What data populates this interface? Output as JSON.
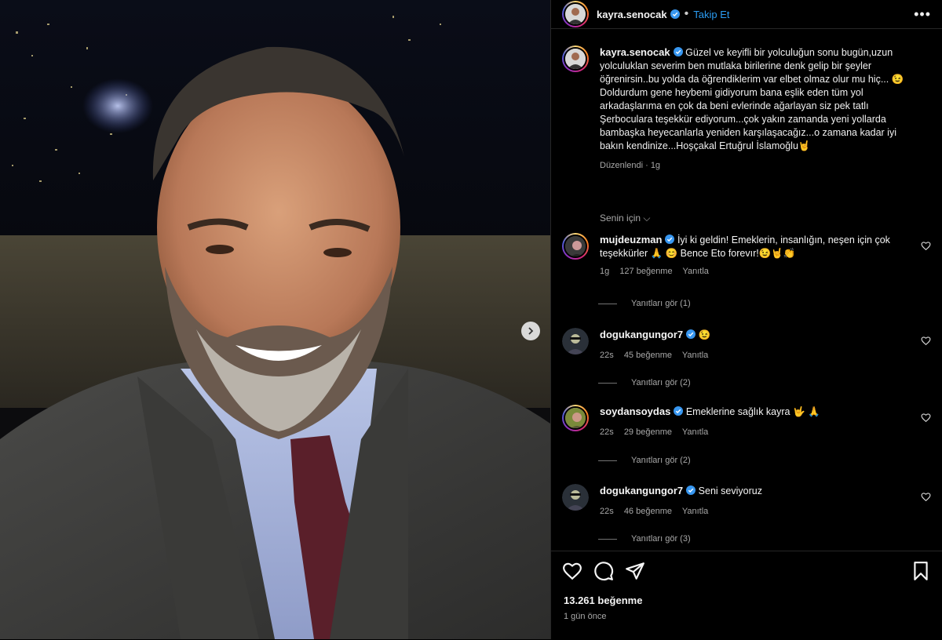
{
  "header": {
    "username": "kayra.senocak",
    "separator": "•",
    "follow_label": "Takip Et",
    "more_label": "•••"
  },
  "caption": {
    "username": "kayra.senocak",
    "text": "Güzel ve keyifli bir yolculuğun sonu bugün,uzun yolculuklan severim ben mutlaka birilerine denk gelip bir şeyler öğrenirsin..bu yolda da öğrendiklerim var elbet olmaz olur mu hiç... 😉 Doldurdum gene heybemi gidiyorum bana eşlik eden tüm yol arkadaşlarıma en çok da beni evlerinde ağarlayan siz pek tatlı Şerbocularа teşekkür ediyorum...çok yakın zamanda yeni yollarda bambaşka heyecanlarla yeniden karşılaşacağız...o zamana kadar iyi bakın kendinize...Hoşçakal Ertuğrul İslamoğlu🤘",
    "edited": "Düzenlendi · 1g"
  },
  "for_you": "Senin için ⌵",
  "comments": [
    {
      "username": "mujdeuzman",
      "text": "İyi ki geldin! Emeklerin, insanlığın, neşen için çok teşekkürler 🙏 😊 Bence Eto forevır!😉🤘👏",
      "time": "1g",
      "likes": "127 beğenme",
      "reply": "Yanıtla",
      "view_replies": "Yanıtları gör (1)"
    },
    {
      "username": "dogukangungor7",
      "text": "😉",
      "time": "22s",
      "likes": "45 beğenme",
      "reply": "Yanıtla",
      "view_replies": "Yanıtları gör (2)"
    },
    {
      "username": "soydansoydas",
      "text": "Emeklerine sağlık kayra 🤟 🙏",
      "time": "22s",
      "likes": "29 beğenme",
      "reply": "Yanıtla",
      "view_replies": "Yanıtları gör (2)"
    },
    {
      "username": "dogukangungor7",
      "text": "Seni seviyoruz",
      "time": "22s",
      "likes": "46 beğenme",
      "reply": "Yanıtla",
      "view_replies": "Yanıtları gör (3)"
    }
  ],
  "actions": {
    "like_icon": "heart-icon",
    "comment_icon": "comment-icon",
    "share_icon": "share-icon",
    "save_icon": "bookmark-icon"
  },
  "likes_count": "13.261 beğenme",
  "posted": "1 gün önce",
  "colors": {
    "accent": "#2b9cf2",
    "muted": "#a8a8a8",
    "background": "#000000"
  }
}
